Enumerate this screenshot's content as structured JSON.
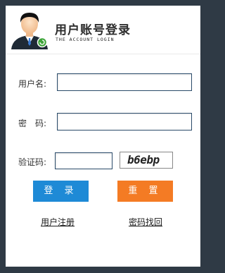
{
  "header": {
    "title": "用户账号登录",
    "subtitle": "THE ACCOUNT LOGIN"
  },
  "form": {
    "username_label": "用户名:",
    "username_value": "",
    "password_label": "密　码:",
    "password_value": "",
    "captcha_label": "验证码:",
    "captcha_value": "",
    "captcha_text": "b6ebp"
  },
  "buttons": {
    "login": "登 录",
    "reset": "重 置"
  },
  "links": {
    "register": "用户注册",
    "recover": "密码找回"
  },
  "colors": {
    "login_button": "#1e8ad6",
    "reset_button": "#f47b24",
    "background": "#2f3a45"
  }
}
